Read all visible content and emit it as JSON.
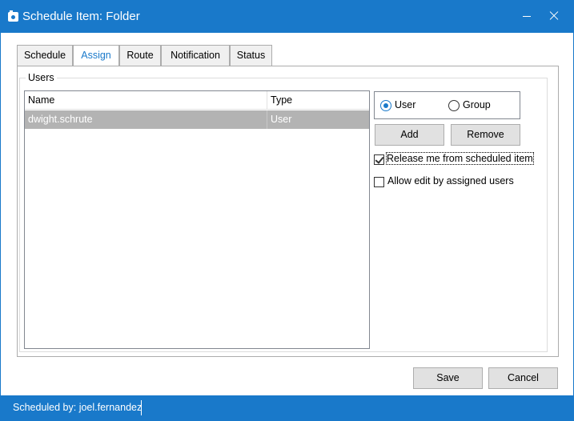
{
  "window": {
    "title": "Schedule Item: Folder",
    "icon": "camera-icon",
    "accent_color": "#1979ca"
  },
  "tabs": [
    {
      "label": "Schedule",
      "active": false
    },
    {
      "label": "Assign",
      "active": true
    },
    {
      "label": "Route",
      "active": false
    },
    {
      "label": "Notification",
      "active": false
    },
    {
      "label": "Status",
      "active": false
    }
  ],
  "users_group": {
    "legend": "Users",
    "columns": [
      "Name",
      "Type"
    ],
    "rows": [
      {
        "name": "dwight.schrute",
        "type": "User",
        "selected": true
      }
    ]
  },
  "assign_type": {
    "options": [
      "User",
      "Group"
    ],
    "selected": "User"
  },
  "buttons": {
    "add": "Add",
    "remove": "Remove",
    "save": "Save",
    "cancel": "Cancel"
  },
  "options": {
    "release": {
      "label": "Release me from scheduled item",
      "checked": true
    },
    "allow_edit": {
      "label": "Allow edit by assigned users",
      "checked": false
    }
  },
  "status": {
    "text": "Scheduled by: joel.fernandez"
  }
}
